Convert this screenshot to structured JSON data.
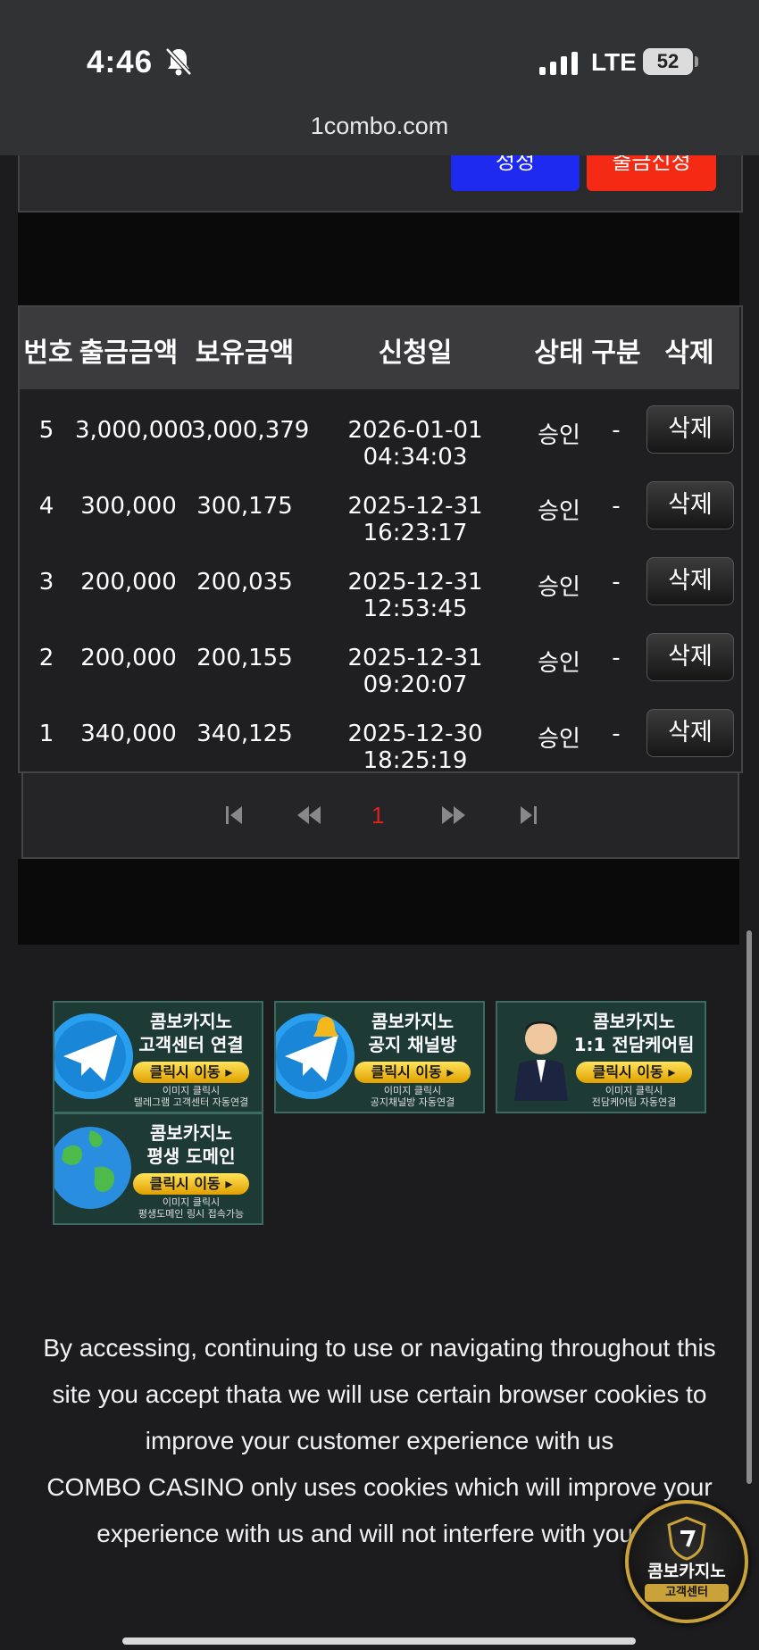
{
  "status_bar": {
    "time": "4:46",
    "network": "LTE",
    "battery": "52"
  },
  "browser": {
    "url": "1combo.com"
  },
  "top_buttons": {
    "blue_label": "정정",
    "red_label": "출금신청"
  },
  "table": {
    "headers": [
      "번호",
      "출금금액",
      "보유금액",
      "신청일",
      "상태",
      "구분",
      "삭제"
    ],
    "rows": [
      {
        "no": "5",
        "amount": "3,000,000",
        "balance": "3,000,379",
        "date": "2026-01-01 04:34:03",
        "status": "승인",
        "type": "-",
        "delete": "삭제"
      },
      {
        "no": "4",
        "amount": "300,000",
        "balance": "300,175",
        "date": "2025-12-31 16:23:17",
        "status": "승인",
        "type": "-",
        "delete": "삭제"
      },
      {
        "no": "3",
        "amount": "200,000",
        "balance": "200,035",
        "date": "2025-12-31 12:53:45",
        "status": "승인",
        "type": "-",
        "delete": "삭제"
      },
      {
        "no": "2",
        "amount": "200,000",
        "balance": "200,155",
        "date": "2025-12-31 09:20:07",
        "status": "승인",
        "type": "-",
        "delete": "삭제"
      },
      {
        "no": "1",
        "amount": "340,000",
        "balance": "340,125",
        "date": "2025-12-30 18:25:19",
        "status": "승인",
        "type": "-",
        "delete": "삭제"
      }
    ]
  },
  "pagination": {
    "current_page": "1",
    "first_icon": "first-page-icon",
    "prev_icon": "prev-page-icon",
    "next_icon": "next-page-icon",
    "last_icon": "last-page-icon"
  },
  "banners": [
    {
      "title_line1": "콤보카지노",
      "title_line2": "고객센터 연결",
      "button": "클릭시 이동 ▸",
      "sub_line1": "이미지 클릭시",
      "sub_line2": "텔레그램 고객센터 자동연결",
      "icon": "telegram-icon"
    },
    {
      "title_line1": "콤보카지노",
      "title_line2": "공지 채널방",
      "button": "클릭시 이동 ▸",
      "sub_line1": "이미지 클릭시",
      "sub_line2": "공지채널방 자동연결",
      "icon": "telegram-bell-icon"
    },
    {
      "title_line1": "콤보카지노",
      "title_line2": "1:1 전담케어팀",
      "button": "클릭시 이동 ▸",
      "sub_line1": "이미지 클릭시",
      "sub_line2": "전담케어팀 자동연결",
      "icon": "agent-avatar-icon"
    },
    {
      "title_line1": "콤보카지노",
      "title_line2": "평생 도메인",
      "button": "클릭시 이동 ▸",
      "sub_line1": "이미지 클릭시",
      "sub_line2": "평생도메인 링시 접속가능",
      "icon": "globe-icon"
    }
  ],
  "cookie_notice": {
    "line1": "By accessing, continuing to use or navigating throughout this",
    "line2": "site you accept thata we will use certain browser cookies to",
    "line3": "improve your customer experience with us",
    "line4": "COMBO CASINO only uses cookies which will improve your",
    "line5": "experience with us and will not interfere with your p"
  },
  "floating_badge": {
    "title": "콤보카지노",
    "subtitle": "고객센터"
  },
  "colors": {
    "blue_button": "#1f2af0",
    "red_button": "#f42a14",
    "page_active": "#e02020",
    "banner_accent": "#ffd23a"
  }
}
